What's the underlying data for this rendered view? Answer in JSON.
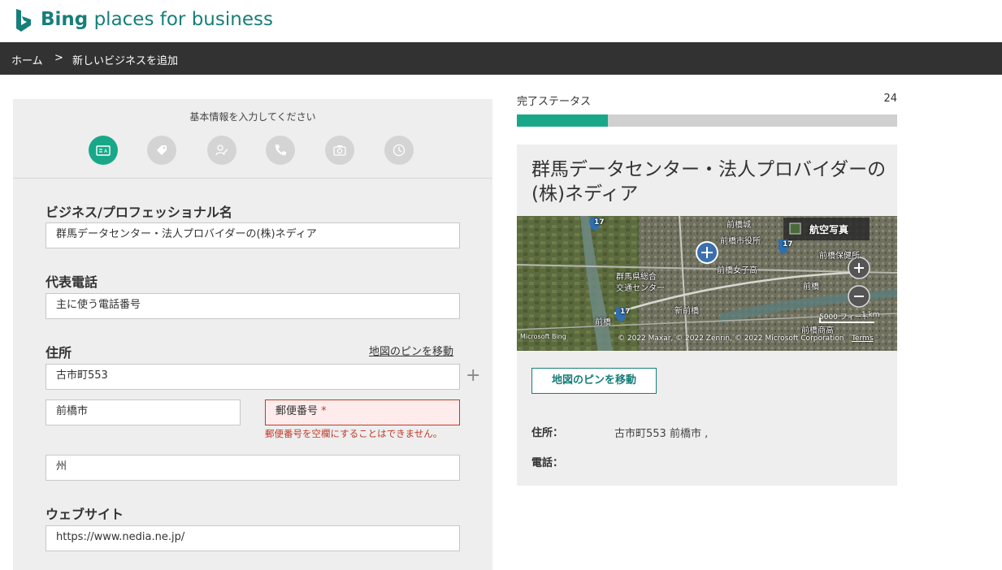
{
  "header": {
    "brand_bold": "Bing",
    "brand_rest": "places for business"
  },
  "breadcrumb": {
    "home": "ホーム",
    "separator": ">",
    "current": "新しいビジネスを追加"
  },
  "form": {
    "prompt": "基本情報を入力してください",
    "steps": [
      {
        "icon": "id-card-icon",
        "active": true
      },
      {
        "icon": "tag-icon",
        "active": false
      },
      {
        "icon": "person-edit-icon",
        "active": false
      },
      {
        "icon": "phone-icon",
        "active": false
      },
      {
        "icon": "camera-icon",
        "active": false
      },
      {
        "icon": "clock-icon",
        "active": false
      }
    ],
    "business_name": {
      "label": "ビジネス/プロフェッショナル名",
      "value": "群馬データセンター・法人プロバイダーの(株)ネディア"
    },
    "phone": {
      "label": "代表電話",
      "placeholder": "主に使う電話番号"
    },
    "address": {
      "label": "住所",
      "move_pin_link": "地図のピンを移動",
      "street": "古市町553",
      "city": "前橋市",
      "postal_placeholder": "郵便番号",
      "required_mark": "*",
      "postal_error": "郵便番号を空欄にすることはできません。",
      "state_placeholder": "州"
    },
    "website": {
      "label": "ウェブサイト",
      "value": "https://www.nedia.ne.jp/"
    }
  },
  "status": {
    "label": "完了ステータス",
    "value": "24",
    "progress_percent": 24
  },
  "preview": {
    "title": "群馬データセンター・法人プロバイダーの(株)ネディア",
    "map": {
      "labels": [
        "前橋城",
        "前橋市役所",
        "前橋保健所",
        "群馬県総合",
        "交通センター",
        "前橋女子高",
        "前橋",
        "新前橋",
        "前橋",
        "前橋商高",
        "17",
        "17",
        "17"
      ],
      "aerial_button": "航空写真",
      "scale_ft": "5000 フィート",
      "scale_km": "1 km",
      "copyright": "© 2022 Maxar, © 2022 Zenrin, © 2022 Microsoft Corporation",
      "terms": "Terms",
      "logo": "Microsoft Bing"
    },
    "move_pin_button": "地図のピンを移動",
    "address_label": "住所：",
    "address_value": "古市町553 前橋市 ,",
    "phone_label": "電話："
  },
  "colors": {
    "brand": "#177e7a",
    "accent": "#18a889",
    "breadcrumb_bg": "#323232",
    "error": "#c0392b"
  }
}
